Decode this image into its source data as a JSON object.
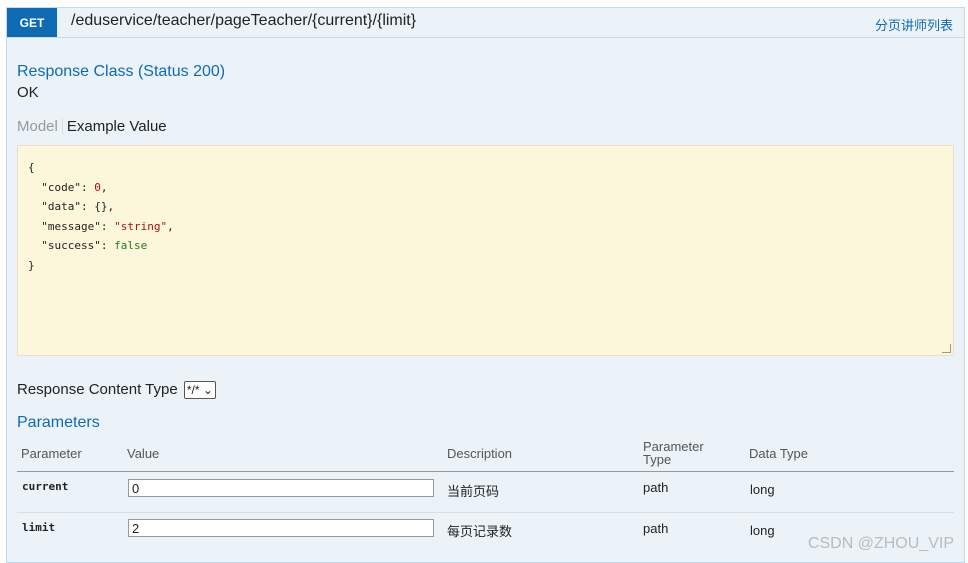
{
  "operation": {
    "method": "GET",
    "path": "/eduservice/teacher/pageTeacher/{current}/{limit}",
    "summary": "分页讲师列表"
  },
  "response": {
    "title": "Response Class (Status 200)",
    "status_text": "OK",
    "tabs": [
      "Model",
      "Example Value"
    ],
    "example": {
      "open": "{",
      "close": "}",
      "fields": [
        {
          "key": "\"code\"",
          "value": "0",
          "kind": "num",
          "sep": ","
        },
        {
          "key": "\"data\"",
          "value": "{}",
          "kind": "plain",
          "sep": ","
        },
        {
          "key": "\"message\"",
          "value": "\"string\"",
          "kind": "str",
          "sep": ","
        },
        {
          "key": "\"success\"",
          "value": "false",
          "kind": "bool",
          "sep": ""
        }
      ]
    },
    "content_type_label": "Response Content Type",
    "content_type_value": "*/*"
  },
  "parameters": {
    "title": "Parameters",
    "headers": {
      "parameter": "Parameter",
      "value": "Value",
      "description": "Description",
      "parameter_type_line1": "Parameter",
      "parameter_type_line2": "Type",
      "data_type": "Data Type"
    },
    "rows": [
      {
        "name": "current",
        "value": "0",
        "description": "当前页码",
        "param_type": "path",
        "data_type": "long"
      },
      {
        "name": "limit",
        "value": "2",
        "description": "每页记录数",
        "param_type": "path",
        "data_type": "long"
      }
    ]
  },
  "watermark": "CSDN @ZHOU_VIP",
  "colors": {
    "accent": "#0f6ab4",
    "panel_bg": "#ebf3f9",
    "example_bg": "#fcf6db"
  }
}
